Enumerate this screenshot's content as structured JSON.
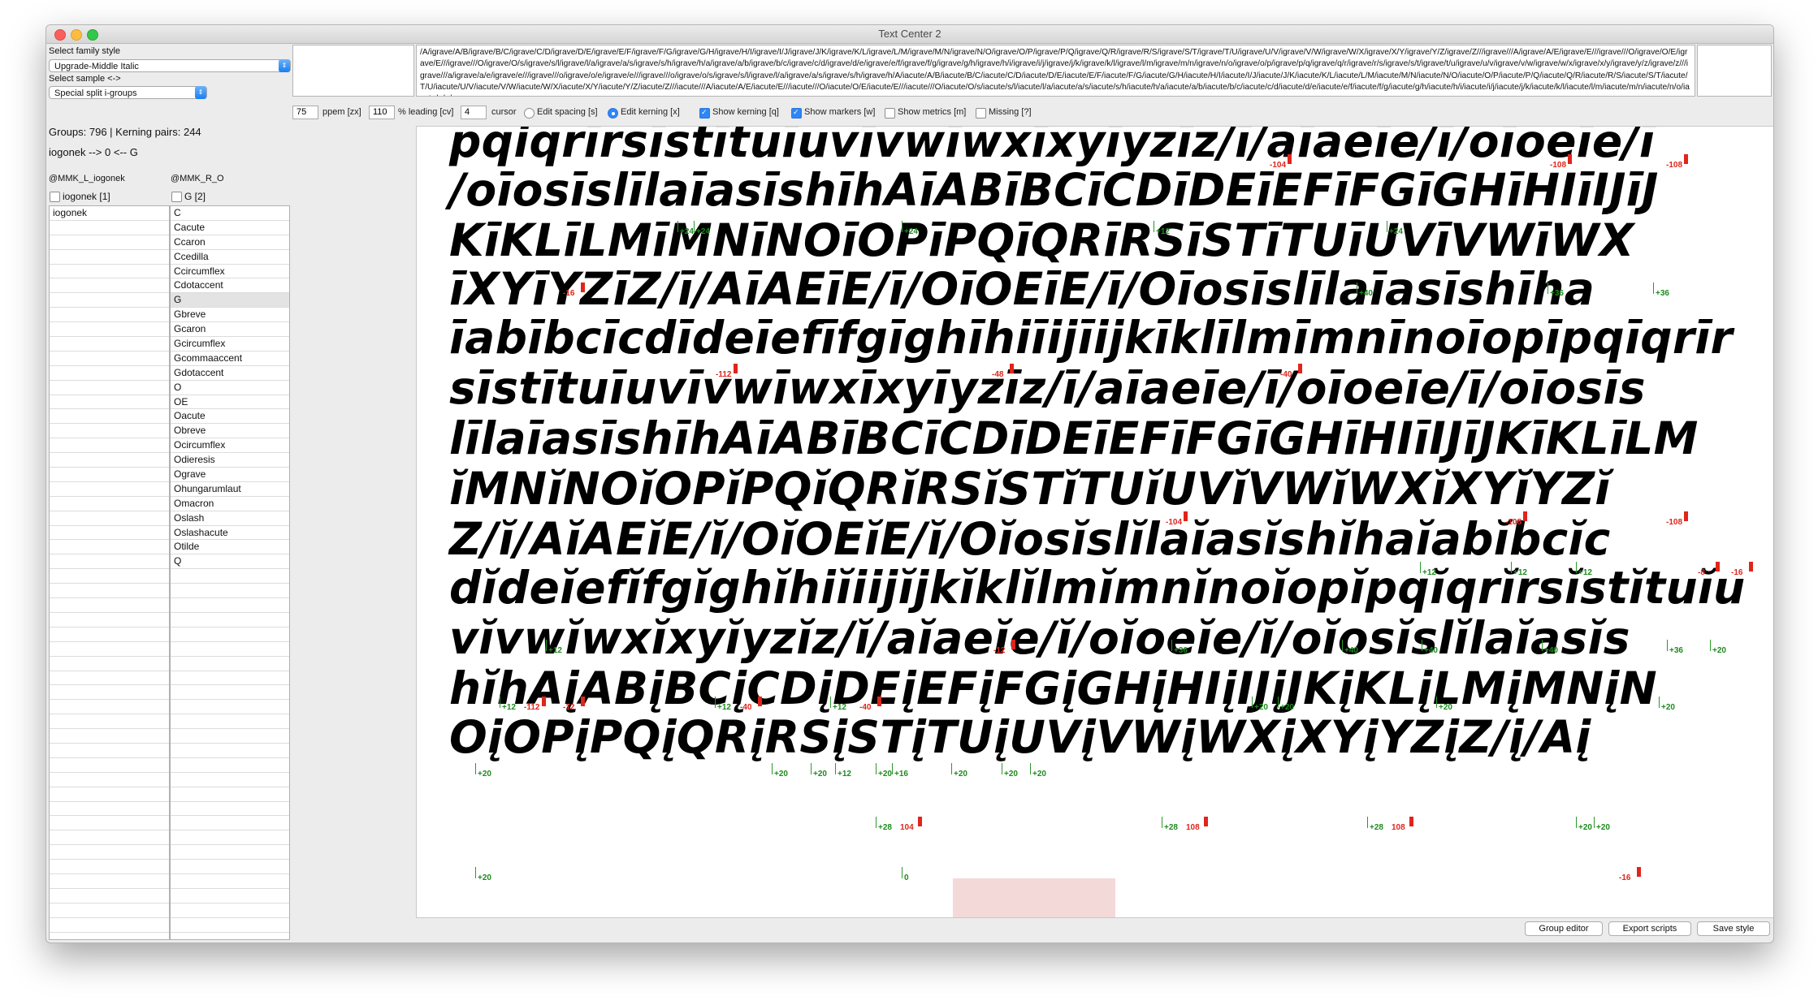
{
  "window": {
    "title": "Text Center 2"
  },
  "sidebar": {
    "family_label": "Select family style",
    "family_value": "Upgrade-Middle Italic",
    "sample_label": "Select sample <->",
    "sample_value": "Special split i-groups",
    "stats": "Groups: 796 | Kerning pairs: 244",
    "pair": "iogonek --> 0 <-- G",
    "left_group": {
      "header": "@MMK_L_iogonek",
      "check_label": "iogonek [1]",
      "items": [
        "iogonek"
      ]
    },
    "right_group": {
      "header": "@MMK_R_O",
      "check_label": "G [2]",
      "items": [
        "C",
        "Cacute",
        "Ccaron",
        "Ccedilla",
        "Ccircumflex",
        "Cdotaccent",
        "G",
        "Gbreve",
        "Gcaron",
        "Gcircumflex",
        "Gcommaaccent",
        "Gdotaccent",
        "O",
        "OE",
        "Oacute",
        "Obreve",
        "Ocircumflex",
        "Odieresis",
        "Ograve",
        "Ohungarumlaut",
        "Omacron",
        "Oslash",
        "Oslashacute",
        "Otilde",
        "Q"
      ],
      "selected": "G"
    }
  },
  "sample_text": "/A/igrave/A/B/igrave/B/C/igrave/C/D/igrave/D/E/igrave/E/F/igrave/F/G/igrave/G/H/igrave/H/I/igrave/I/J/igrave/J/K/igrave/K/L/igrave/L/M/igrave/M/N/igrave/N/O/igrave/O/P/igrave/P/Q/igrave/Q/R/igrave/R/S/igrave/S/T/igrave/T/U/igrave/U/V/igrave/V/W/igrave/W/X/igrave/X/Y/igrave/Y/Z/igrave/Z///igrave///A/igrave/A/E/igrave/E///igrave///O/igrave/O/E/igrave/E///igrave///O/igrave/O/s/igrave/s/l/igrave/l/a/igrave/a/s/igrave/s/h/igrave/h/a/igrave/a/b/igrave/b/c/igrave/c/d/igrave/d/e/igrave/e/f/igrave/f/g/igrave/g/h/igrave/h/i/igrave/i/j/igrave/j/k/igrave/k/l/igrave/l/m/igrave/m/n/igrave/n/o/igrave/o/p/igrave/p/q/igrave/q/r/igrave/r/s/igrave/s/t/igrave/t/u/igrave/u/v/igrave/v/w/igrave/w/x/igrave/x/y/igrave/y/z/igrave/z///igrave///a/igrave/a/e/igrave/e///igrave///o/igrave/o/e/igrave/e///igrave///o/igrave/o/s/igrave/s/l/igrave/l/a/igrave/a/s/igrave/s/h/igrave/h/A/iacute/A/B/iacute/B/C/iacute/C/D/iacute/D/E/iacute/E/F/iacute/F/G/iacute/G/H/iacute/H/I/iacute/I/J/iacute/J/K/iacute/K/L/iacute/L/M/iacute/M/N/iacute/N/O/iacute/O/P/iacute/P/Q/iacute/Q/R/iacute/R/S/iacute/S/T/iacute/T/U/iacute/U/V/iacute/V/W/iacute/W/X/iacute/X/Y/iacute/Y/Z/iacute/Z///iacute///A/iacute/A/E/iacute/E///iacute///O/iacute/O/E/iacute/E///iacute///O/iacute/O/s/iacute/s/l/iacute/l/a/iacute/a/s/iacute/s/h/iacute/h/a/iacute/a/b/iacute/b/c/iacute/c/d/iacute/d/e/iacute/e/f/iacute/f/g/iacute/g/h/iacute/h/i/iacute/i/j/iacute/j/k/iacute/k/l/iacute/l/m/iacute/m/n/iacute/n/o/iacute/o/p/",
  "controls": {
    "ppem_value": "75",
    "ppem_label": "ppem [zx]",
    "leading_value": "110",
    "leading_label": "% leading [cv]",
    "cursor_value": "4",
    "cursor_label": "cursor",
    "edit_spacing": "Edit spacing [s]",
    "edit_kerning": "Edit kerning [x]",
    "show_kerning": "Show kerning [q]",
    "show_markers": "Show markers [w]",
    "show_metrics": "Show metrics [m]",
    "missing": "Missing [?]"
  },
  "preview_lines": [
    "pqiqrīrsīstītuīuvīvwīwxīxyīyzīz/ī/aīaeīe/ī/oīoeīe/ī",
    "/oīosīslīlaīasīshīhAīABīBCīCDīDEīEFīFGīGHīHIīIJīJ",
    "KīKLīLMīMNīNOīOPīPQīQRīRSīSTīTUīUVīVWīWX",
    "īXYīYZīZ/ī/AīAEīE/ī/OīOEīE/ī/Oīosīslīlaīasīshīha",
    "īabībcīcdīdeīefīfgīghīhiīijīĳkīklīlmīmnīnoīopīpqīqrīr",
    "sīstītuīuvīvwīwxīxyīyzīz/ī/aīaeīe/ī/oīoeīe/ī/oīosīs",
    "līlaīasīshīhAīABīBCīCDīDEīEFīFGīGHīHIīIJīJKīKLīLM",
    "ĭMNĭNOĭOPĭPQĭQRĭRSĭSTĭTUĭUVĭVWĭWXĭXYĭYZĭ",
    "Z/ĭ/AĭAEĭE/ĭ/OĭOEĭE/ĭ/Oĭosĭslĭlaĭasĭshĭhaĭabĭbcĭc",
    "dĭdeĭefĭfgĭghĭhiĭiĳĭjkĭklĭlmĭmnĭnoĭopĭpqĭqrĭrsĭstĭtuĭu",
    "vĭvwĭwxĭxyĭyzĭz/ĭ/aĭaeĭe/ĭ/oĭoeĭe/ĭ/oĭosĭslĭlaĭasĭs",
    "hĭhAįABįBCįCDįDEįEFįFGįGHįHIįIJįJKįKLįLMįMNįN",
    "OįOPįPQįQRįRSįSTįTUįUVįVWįWXįXYįYZįZ/į/Aį"
  ],
  "kern_labels": [
    {
      "t": "-104",
      "c": "neg"
    },
    {
      "t": "-108",
      "c": "neg"
    },
    {
      "t": "-108",
      "c": "neg"
    },
    {
      "t": "+24",
      "c": "pos"
    },
    {
      "t": "+24",
      "c": "pos"
    },
    {
      "t": "+24",
      "c": "pos"
    },
    {
      "t": "+12",
      "c": "pos"
    },
    {
      "t": "+24",
      "c": "pos"
    },
    {
      "t": "-16",
      "c": "neg"
    },
    {
      "t": "+40",
      "c": "pos"
    },
    {
      "t": "+36",
      "c": "pos"
    },
    {
      "t": "+36",
      "c": "pos"
    },
    {
      "t": "-112",
      "c": "neg"
    },
    {
      "t": "-48",
      "c": "neg"
    },
    {
      "t": "-40",
      "c": "neg"
    },
    {
      "t": "-104",
      "c": "neg"
    },
    {
      "t": "-108",
      "c": "neg"
    },
    {
      "t": "-108",
      "c": "neg"
    },
    {
      "t": "+12",
      "c": "pos"
    },
    {
      "t": "+12",
      "c": "pos"
    },
    {
      "t": "+12",
      "c": "pos"
    },
    {
      "t": "-8",
      "c": "neg"
    },
    {
      "t": "-16",
      "c": "neg"
    },
    {
      "t": "+12",
      "c": "pos"
    },
    {
      "t": "-12",
      "c": "neg"
    },
    {
      "t": "+36",
      "c": "pos"
    },
    {
      "t": "+40",
      "c": "pos"
    },
    {
      "t": "+40",
      "c": "pos"
    },
    {
      "t": "+40",
      "c": "pos"
    },
    {
      "t": "+36",
      "c": "pos"
    },
    {
      "t": "+20",
      "c": "pos"
    },
    {
      "t": "+12",
      "c": "pos"
    },
    {
      "t": "-112",
      "c": "neg"
    },
    {
      "t": "-12",
      "c": "neg"
    },
    {
      "t": "+12",
      "c": "pos"
    },
    {
      "t": "-40",
      "c": "neg"
    },
    {
      "t": "+12",
      "c": "pos"
    },
    {
      "t": "-40",
      "c": "neg"
    },
    {
      "t": "+20",
      "c": "pos"
    },
    {
      "t": "+20",
      "c": "pos"
    },
    {
      "t": "+20",
      "c": "pos"
    },
    {
      "t": "+20",
      "c": "pos"
    },
    {
      "t": "+20",
      "c": "pos"
    },
    {
      "t": "+20",
      "c": "pos"
    },
    {
      "t": "+20",
      "c": "pos"
    },
    {
      "t": "+12",
      "c": "pos"
    },
    {
      "t": "+20",
      "c": "pos"
    },
    {
      "t": "+16",
      "c": "pos"
    },
    {
      "t": "+20",
      "c": "pos"
    },
    {
      "t": "+20",
      "c": "pos"
    },
    {
      "t": "+20",
      "c": "pos"
    },
    {
      "t": "+28",
      "c": "pos"
    },
    {
      "t": "104",
      "c": "neg"
    },
    {
      "t": "+28",
      "c": "pos"
    },
    {
      "t": "108",
      "c": "neg"
    },
    {
      "t": "+28",
      "c": "pos"
    },
    {
      "t": "108",
      "c": "neg"
    },
    {
      "t": "+20",
      "c": "pos"
    },
    {
      "t": "+20",
      "c": "pos"
    },
    {
      "t": "+20",
      "c": "pos"
    },
    {
      "t": "0",
      "c": "pos"
    },
    {
      "t": "-16",
      "c": "neg"
    }
  ],
  "buttons": {
    "group_editor": "Group editor",
    "export_scripts": "Export scripts",
    "save_style": "Save style"
  }
}
